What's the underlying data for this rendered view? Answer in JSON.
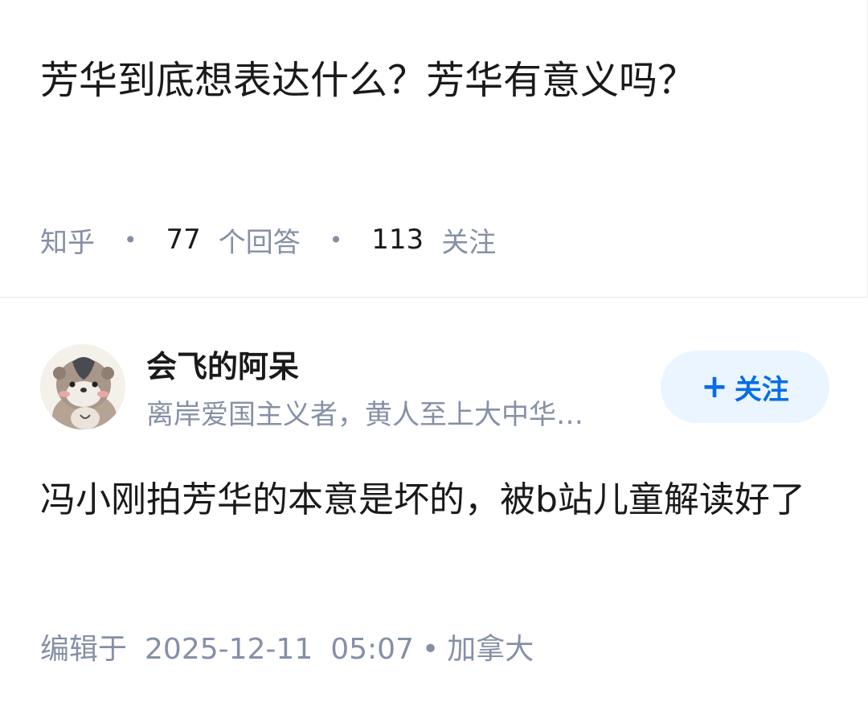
{
  "question": {
    "title": "芳华到底想表达什么？芳华有意义吗？",
    "source": "知乎",
    "answers_count": "77",
    "answers_label": "个回答",
    "followers_count": "113",
    "followers_label": "关注"
  },
  "answer": {
    "author": {
      "name": "会飞的阿呆",
      "bio": "离岸爱国主义者，黄人至上大中华…",
      "avatar_icon": "otter-avatar-icon"
    },
    "follow_button": {
      "plus": "+",
      "label": "关注"
    },
    "content": "冯小刚拍芳华的本意是坏的，被b站儿童解读好了",
    "meta": {
      "edited_label": "编辑于",
      "date": "2025-12-11",
      "time": "05:07",
      "location": "加拿大"
    }
  },
  "colors": {
    "primary_text": "#1a1a1a",
    "secondary_text": "#8590a6",
    "accent": "#056de8",
    "follow_bg": "#ebf5ff"
  }
}
